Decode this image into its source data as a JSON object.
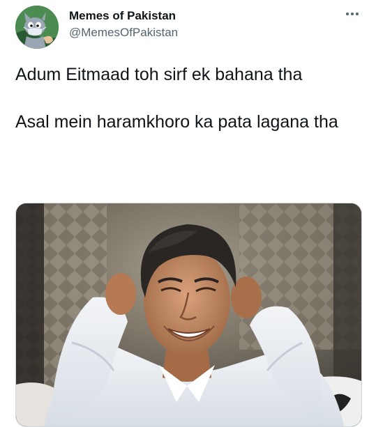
{
  "tweet": {
    "author": {
      "display_name": "Memes of Pakistan",
      "handle": "@MemesOfPakistan",
      "avatar_icon": "cartoon-cat-avatar"
    },
    "more_icon": "more-options-icon",
    "text_lines": [
      "Adum Eitmaad toh sirf ek bahana tha",
      "Asal mein haramkhoro ka pata lagana tha"
    ],
    "media": {
      "kind": "photo",
      "subject": "smiling man in white shirt with hands behind head"
    }
  },
  "colors": {
    "text_primary": "#0f1419",
    "text_secondary": "#536471",
    "border": "#cfd9de",
    "background": "#ffffff"
  }
}
